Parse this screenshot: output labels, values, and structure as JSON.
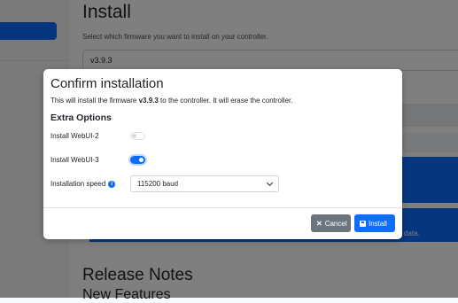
{
  "background": {
    "title": "Install",
    "subtitle": "Select which firmware you want to install on your controller.",
    "selected_version": "v3.9.3",
    "banner_tail": "data.",
    "release_notes_heading": "Release Notes",
    "new_features_heading": "New Features"
  },
  "modal": {
    "title": "Confirm installation",
    "desc_prefix": "This will install the firmware ",
    "desc_version": "v3.9.3",
    "desc_suffix": " to the controller. It will erase the controller.",
    "section_title": "Extra Options",
    "webui2": {
      "label": "Install WebUI-2",
      "enabled": false
    },
    "webui3": {
      "label": "Install WebUI-3",
      "enabled": true
    },
    "speed": {
      "label": "Installation speed",
      "value": "115200 baud"
    },
    "cancel_label": "Cancel",
    "install_label": "Install"
  },
  "colors": {
    "primary": "#0d6efd",
    "secondary": "#6c757d"
  }
}
